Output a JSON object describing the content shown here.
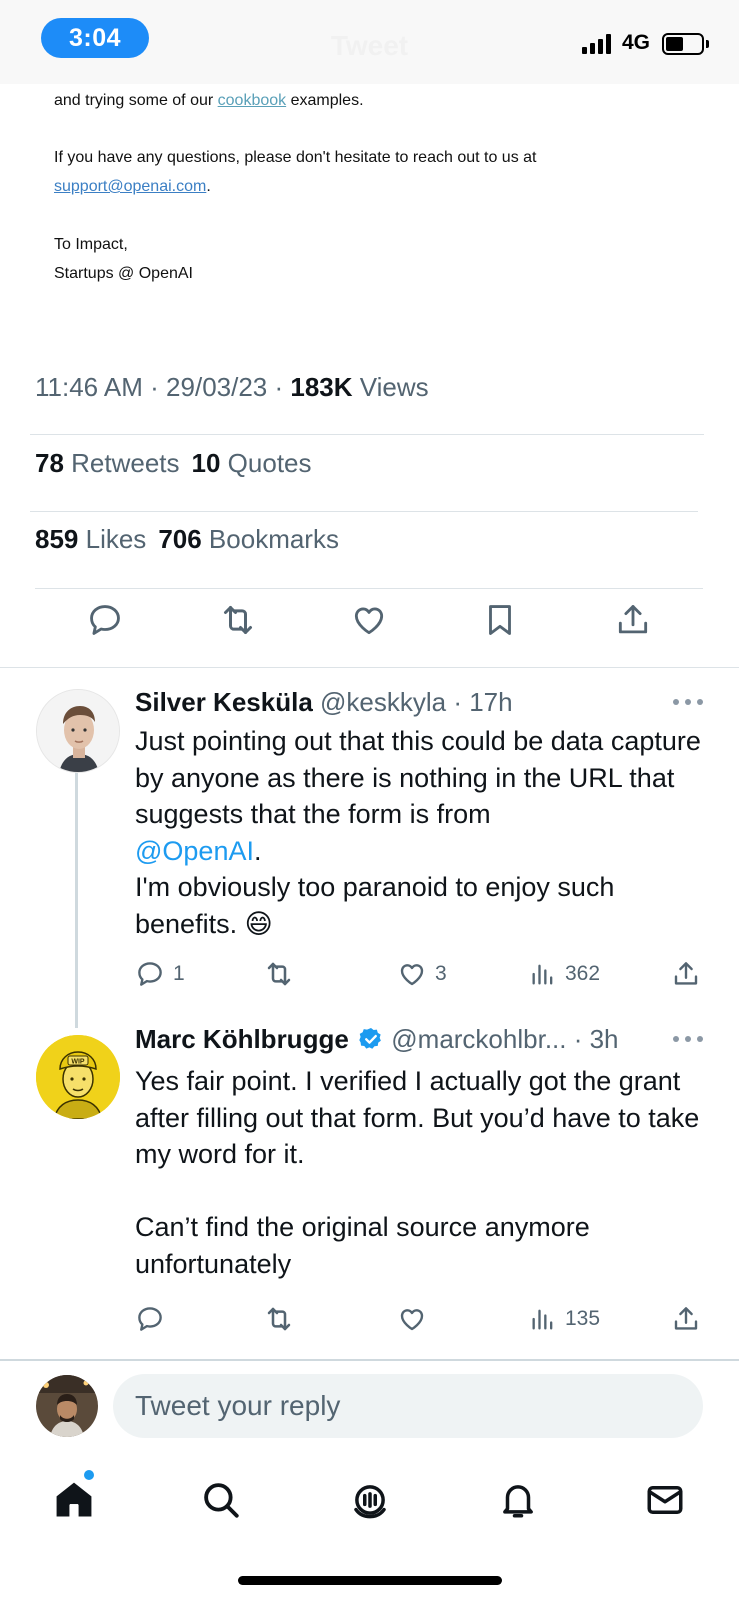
{
  "status_bar": {
    "time": "3:04",
    "title": "Tweet",
    "network": "4G"
  },
  "email": {
    "line1_pre": "and trying some of our ",
    "line1_link": "cookbook",
    "line1_post": " examples.",
    "line2": "If you have any questions, please don't hesitate to reach out to us at",
    "line3_link": "support@openai.com",
    "line3_post": ".",
    "sign1": "To Impact,",
    "sign2": "Startups @ OpenAI"
  },
  "tweet_meta": {
    "time": "11:46 AM",
    "sep1": " · ",
    "date": "29/03/23",
    "sep2": " · ",
    "views_count": "183K",
    "views_label": " Views",
    "retweets_count": "78",
    "retweets_label": " Retweets",
    "quotes_count": "10",
    "quotes_label": " Quotes",
    "likes_count": "859",
    "likes_label": " Likes",
    "bookmarks_count": "706",
    "bookmarks_label": " Bookmarks"
  },
  "replies": [
    {
      "name": "Silver Kesküla",
      "handle": " @keskkyla · 17h",
      "text_1": "Just pointing out that this could be data capture by anyone as there is nothing in the URL that suggests that the form is from",
      "mention": "@OpenAI",
      "text_2": ".",
      "text_3": "I'm obviously too paranoid to enjoy such benefits. 😄",
      "reply_count": "1",
      "retweet_count": "",
      "like_count": "3",
      "view_count": "362",
      "verified": false
    },
    {
      "name": "Marc Köhlbrugge",
      "handle": " @marckohlbr... · 3h",
      "text_1": "Yes fair point. I verified I actually got the grant after filling out that form. But you’d have to take my word for it.",
      "text_2": "Can’t find the original source anymore unfortunately",
      "reply_count": "",
      "retweet_count": "",
      "like_count": "",
      "view_count": "135",
      "verified": true
    }
  ],
  "compose": {
    "placeholder": "Tweet your reply"
  },
  "colors": {
    "accent": "#1d9bf0",
    "secondary_text": "#536471",
    "primary_text": "#0f1419",
    "time_pill": "#1d8cf8"
  },
  "icons": {
    "reply": "reply-icon",
    "retweet": "retweet-icon",
    "like": "heart-icon",
    "bookmark": "bookmark-icon",
    "share": "share-icon",
    "views": "views-icon",
    "home": "home-icon",
    "search": "search-icon",
    "spaces": "spaces-icon",
    "notifications": "bell-icon",
    "messages": "mail-icon"
  }
}
